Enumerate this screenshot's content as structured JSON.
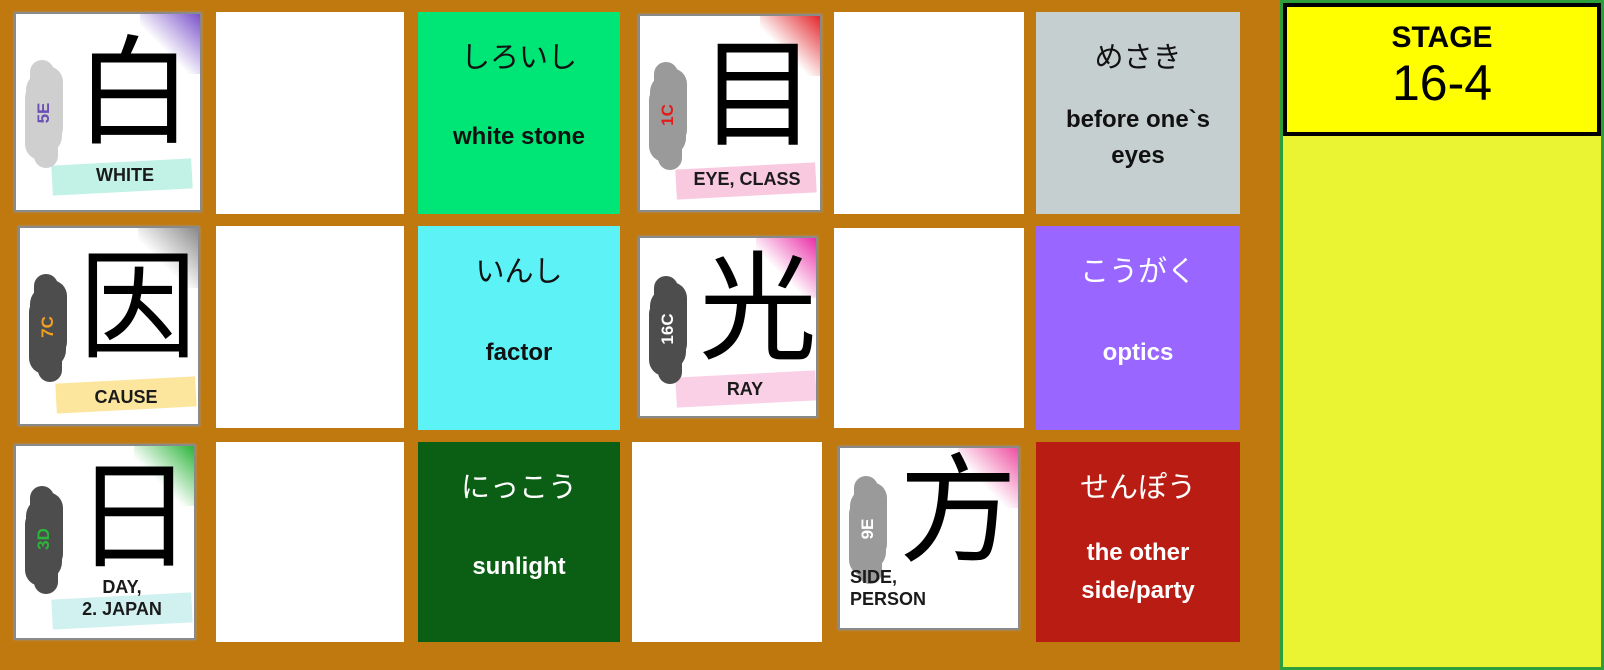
{
  "stage": {
    "label": "STAGE",
    "number": "16-4"
  },
  "kanji_cards": [
    {
      "kanji": "白",
      "code": "5E",
      "meaning": "WHITE",
      "code_color": "#6a4fb5",
      "accent": "#7a52c9",
      "highlight": "#b7efe0",
      "cloud": "light"
    },
    {
      "kanji": "目",
      "code": "1C",
      "meaning": "EYE, CLASS",
      "code_color": "#e21b1b",
      "accent": "#e3262b",
      "highlight": "#f7bfd9",
      "cloud": "mid"
    },
    {
      "kanji": "因",
      "code": "7C",
      "meaning": "CAUSE",
      "code_color": "#f0a020",
      "accent": "#8a8a8a",
      "highlight": "#fbe28c",
      "cloud": "dark"
    },
    {
      "kanji": "光",
      "code": "16C",
      "meaning": "RAY",
      "code_color": "#ffffff",
      "accent": "#ea2fa8",
      "highlight": "#f8c8e2",
      "cloud": "dark"
    },
    {
      "kanji": "日",
      "code": "3D",
      "meaning": "DAY,\n2. JAPAN",
      "code_color": "#2bb53a",
      "accent": "#2bb53a",
      "highlight": "#c9eeee",
      "cloud": "dark"
    },
    {
      "kanji": "方",
      "code": "9E",
      "meaning": "SIDE,\n     PERSON",
      "code_color": "#ffffff",
      "accent": "#ee4fa0",
      "highlight": "#ffffff",
      "cloud": "mid"
    }
  ],
  "word_tiles": [
    {
      "kana": "しろいし",
      "english": "white stone",
      "bg": "#00e676",
      "fg": "#111111"
    },
    {
      "kana": "めさき",
      "english": "before one`s\neyes",
      "bg": "#c5cfcf",
      "fg": "#111111"
    },
    {
      "kana": "いんし",
      "english": "factor",
      "bg": "#5cf2f6",
      "fg": "#111111"
    },
    {
      "kana": "こうがく",
      "english": "optics",
      "bg": "#9966ff",
      "fg": "#ffffff"
    },
    {
      "kana": "にっこう",
      "english": "sunlight",
      "bg": "#0a5f14",
      "fg": "#ffffff"
    },
    {
      "kana": "せんぽう",
      "english": "the other\nside/party",
      "bg": "#b81c12",
      "fg": "#ffffff"
    }
  ],
  "colors": {
    "board": "#c0790e",
    "stage_panel": "#ebf433",
    "stage_box": "#ffff00",
    "stage_border": "#2e9e3c"
  }
}
